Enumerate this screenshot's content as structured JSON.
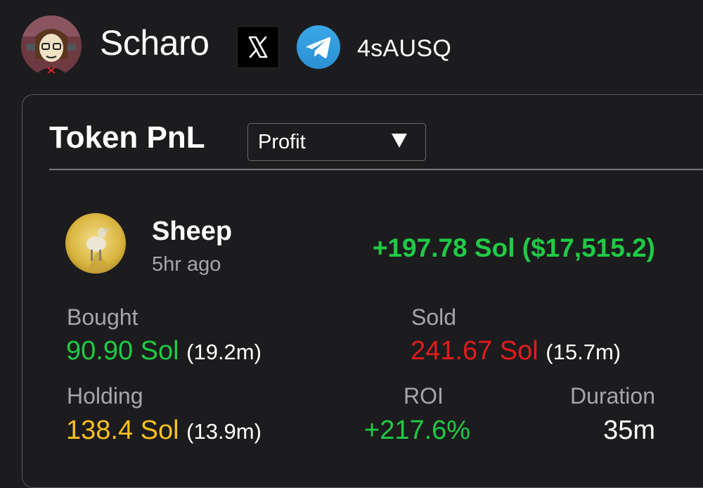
{
  "header": {
    "username": "Scharo",
    "social_x_icon": "x-logo-icon",
    "social_telegram_icon": "telegram-icon",
    "address_short": "4sAUSQ"
  },
  "card": {
    "title": "Token PnL",
    "filter": {
      "selected": "Profit"
    }
  },
  "token": {
    "name": "Sheep",
    "time_ago": "5hr ago",
    "pnl": "+197.78 Sol ($17,515.2)"
  },
  "stats": {
    "bought": {
      "label": "Bought",
      "value": "90.90 Sol",
      "sub": "(19.2m)"
    },
    "sold": {
      "label": "Sold",
      "value": "241.67 Sol",
      "sub": "(15.7m)"
    },
    "holding": {
      "label": "Holding",
      "value": "138.4 Sol",
      "sub": "(13.9m)"
    },
    "roi": {
      "label": "ROI",
      "value": "+217.6%"
    },
    "duration": {
      "label": "Duration",
      "value": "35m"
    }
  },
  "colors": {
    "background": "#1c1c1e",
    "positive": "#1fcb45",
    "negative": "#e21c1c",
    "holding": "#f7c120",
    "muted_label": "#a7a7aa"
  }
}
